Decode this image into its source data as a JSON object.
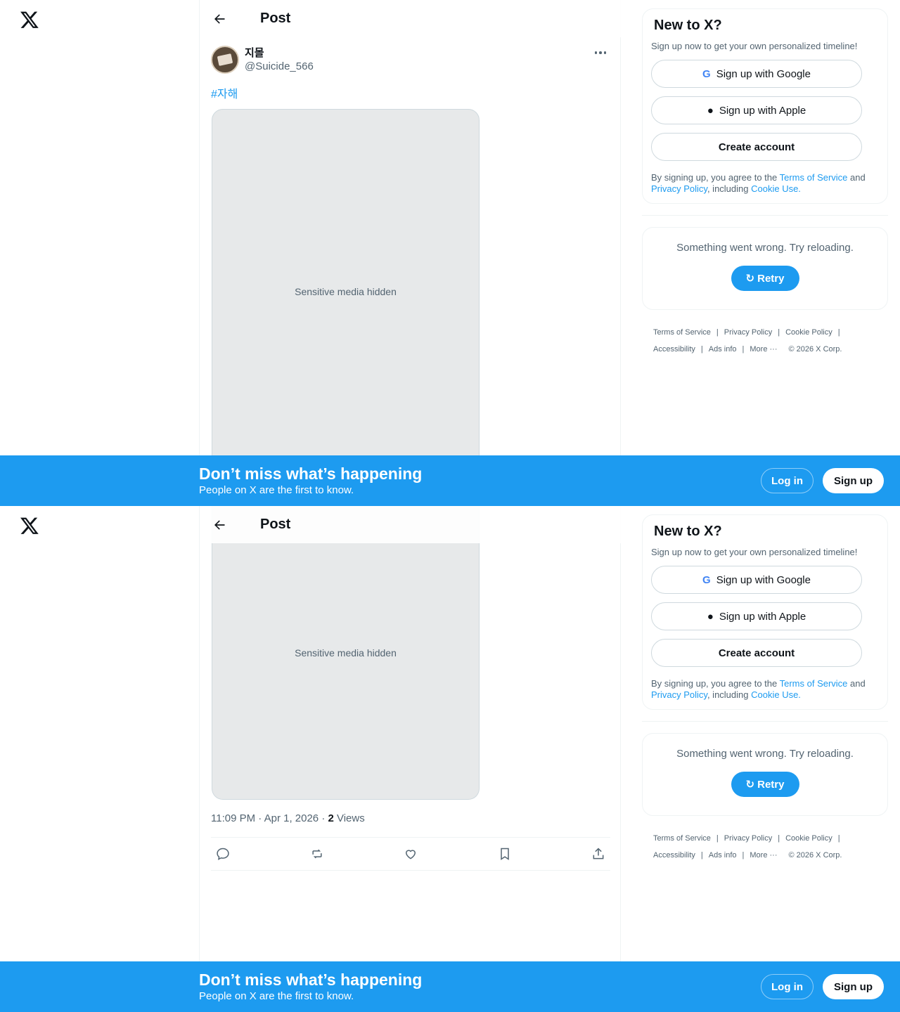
{
  "header": {
    "title": "Post"
  },
  "post": {
    "display_name": "지몰",
    "handle": "@Suicide_566",
    "hashtag": "#자해",
    "media_placeholder": "Sensitive media hidden",
    "timestamp": "11:09 PM · Apr 1, 2026 · ",
    "views_count": "2",
    "views_label": " Views"
  },
  "signup": {
    "title": "New to X?",
    "subtitle": "Sign up now to get your own personalized timeline!",
    "google_label": "Sign up with Google",
    "apple_label": "Sign up with Apple",
    "create_label": "Create account",
    "legal_prefix": "By signing up, you agree to the ",
    "terms_link": "Terms of Service",
    "legal_and": " and ",
    "privacy_link": "Privacy Policy",
    "legal_including": ", including ",
    "cookie_link": "Cookie Use."
  },
  "error": {
    "message": "Something went wrong. Try reloading.",
    "retry_label": "Retry"
  },
  "footer": {
    "links": [
      "Terms of Service",
      "Privacy Policy",
      "Cookie Policy",
      "Accessibility",
      "Ads info",
      "More ···"
    ],
    "copyright": "© 2026 X Corp."
  },
  "banner": {
    "title": "Don’t miss what’s happening",
    "subtitle": "People on X are the first to know.",
    "login_label": "Log in",
    "signup_label": "Sign up"
  },
  "colors": {
    "accent": "#1d9bf0",
    "text": "#0f1419",
    "muted": "#536471"
  }
}
